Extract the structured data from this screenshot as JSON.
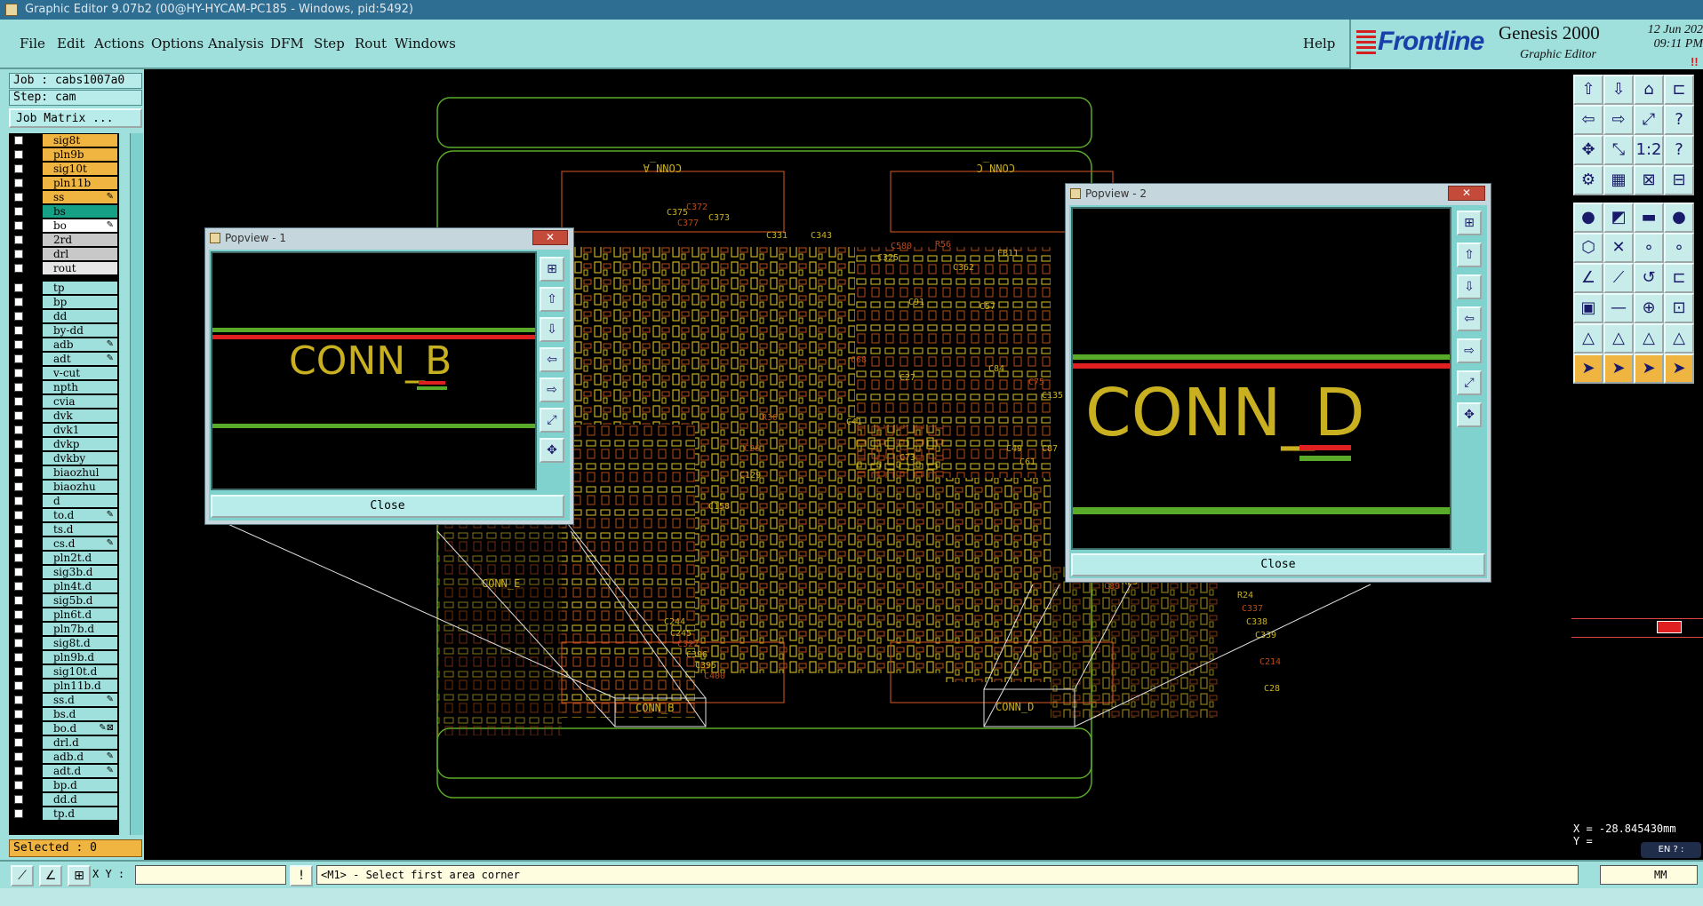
{
  "window": {
    "title": "Graphic Editor 9.07b2 (00@HY-HYCAM-PC185 - Windows, pid:5492)"
  },
  "menu": {
    "items": [
      "File",
      "Edit",
      "Actions",
      "Options",
      "Analysis",
      "DFM",
      "Step",
      "Rout",
      "Windows"
    ],
    "help": "Help"
  },
  "brand": {
    "logo": "Frontline",
    "product": "Genesis 2000",
    "subtitle": "Graphic Editor",
    "date": "12 Jun 202",
    "time": "09:11 PM",
    "indicator": "!!"
  },
  "job": {
    "job_label": "Job : cabs1007a0",
    "step_label": "Step: cam",
    "matrix_button": "Job Matrix ..."
  },
  "layers": [
    {
      "name": "sig8t",
      "color": "#f0b440",
      "mark": ""
    },
    {
      "name": "pln9b",
      "color": "#f0b440",
      "mark": ""
    },
    {
      "name": "sig10t",
      "color": "#f0b440",
      "mark": ""
    },
    {
      "name": "pln11b",
      "color": "#f0b440",
      "mark": ""
    },
    {
      "name": "ss",
      "color": "#f0b440",
      "mark": "✎"
    },
    {
      "name": "bs",
      "color": "#16a085",
      "mark": ""
    },
    {
      "name": "bo",
      "color": "#ffffff",
      "mark": "✎"
    },
    {
      "name": "2rd",
      "color": "#c8c8c8",
      "mark": ""
    },
    {
      "name": "drl",
      "color": "#c8c8c8",
      "mark": ""
    },
    {
      "name": "rout",
      "color": "#e6e6e6",
      "mark": ""
    },
    {
      "name": "tp",
      "color": "#9fdfdc",
      "mark": ""
    },
    {
      "name": "bp",
      "color": "#9fdfdc",
      "mark": ""
    },
    {
      "name": "dd",
      "color": "#9fdfdc",
      "mark": ""
    },
    {
      "name": "by-dd",
      "color": "#9fdfdc",
      "mark": ""
    },
    {
      "name": "adb",
      "color": "#9fdfdc",
      "mark": "✎"
    },
    {
      "name": "adt",
      "color": "#9fdfdc",
      "mark": "✎"
    },
    {
      "name": "v-cut",
      "color": "#9fdfdc",
      "mark": ""
    },
    {
      "name": "npth",
      "color": "#9fdfdc",
      "mark": ""
    },
    {
      "name": "cvia",
      "color": "#9fdfdc",
      "mark": ""
    },
    {
      "name": "dvk",
      "color": "#9fdfdc",
      "mark": ""
    },
    {
      "name": "dvk1",
      "color": "#9fdfdc",
      "mark": ""
    },
    {
      "name": "dvkp",
      "color": "#9fdfdc",
      "mark": ""
    },
    {
      "name": "dvkby",
      "color": "#9fdfdc",
      "mark": ""
    },
    {
      "name": "biaozhul",
      "color": "#9fdfdc",
      "mark": ""
    },
    {
      "name": "biaozhu",
      "color": "#9fdfdc",
      "mark": ""
    },
    {
      "name": "d",
      "color": "#9fdfdc",
      "mark": ""
    },
    {
      "name": "to.d",
      "color": "#9fdfdc",
      "mark": "✎"
    },
    {
      "name": "ts.d",
      "color": "#9fdfdc",
      "mark": ""
    },
    {
      "name": "cs.d",
      "color": "#9fdfdc",
      "mark": "✎"
    },
    {
      "name": "pln2t.d",
      "color": "#9fdfdc",
      "mark": ""
    },
    {
      "name": "sig3b.d",
      "color": "#9fdfdc",
      "mark": ""
    },
    {
      "name": "pln4t.d",
      "color": "#9fdfdc",
      "mark": ""
    },
    {
      "name": "sig5b.d",
      "color": "#9fdfdc",
      "mark": ""
    },
    {
      "name": "pln6t.d",
      "color": "#9fdfdc",
      "mark": ""
    },
    {
      "name": "pln7b.d",
      "color": "#9fdfdc",
      "mark": ""
    },
    {
      "name": "sig8t.d",
      "color": "#9fdfdc",
      "mark": ""
    },
    {
      "name": "pln9b.d",
      "color": "#9fdfdc",
      "mark": ""
    },
    {
      "name": "sig10t.d",
      "color": "#9fdfdc",
      "mark": ""
    },
    {
      "name": "pln11b.d",
      "color": "#9fdfdc",
      "mark": ""
    },
    {
      "name": "ss.d",
      "color": "#9fdfdc",
      "mark": "✎"
    },
    {
      "name": "bs.d",
      "color": "#9fdfdc",
      "mark": ""
    },
    {
      "name": "bo.d",
      "color": "#9fdfdc",
      "mark": "✎⊠"
    },
    {
      "name": "drl.d",
      "color": "#9fdfdc",
      "mark": ""
    },
    {
      "name": "adb.d",
      "color": "#9fdfdc",
      "mark": "✎"
    },
    {
      "name": "adt.d",
      "color": "#9fdfdc",
      "mark": "✎"
    },
    {
      "name": "bp.d",
      "color": "#9fdfdc",
      "mark": ""
    },
    {
      "name": "dd.d",
      "color": "#9fdfdc",
      "mark": ""
    },
    {
      "name": "tp.d",
      "color": "#9fdfdc",
      "mark": ""
    }
  ],
  "selected": "Selected : 0",
  "canvas": {
    "labels": {
      "conn_a": "CONN_A",
      "conn_c": "CONN_C",
      "conn_b": "CONN_B",
      "conn_d": "CONN_D",
      "conn_e": "CONN_E"
    },
    "silkscreen_text": [
      "C372",
      "C373",
      "C375",
      "C377",
      "C331",
      "C343",
      "C584",
      "FB2",
      "C585",
      "C580",
      "C362",
      "C325",
      "R56",
      "FB11",
      "C57",
      "C44",
      "C49",
      "C61",
      "C75",
      "C135",
      "C84",
      "C19",
      "C15",
      "C87",
      "C89",
      "C244",
      "C245",
      "C322",
      "C396",
      "C395",
      "C400",
      "R25",
      "R24",
      "C337",
      "C338",
      "C339",
      "C214",
      "C28",
      "C27",
      "C26",
      "C73",
      "C158",
      "R30",
      "C41",
      "C129",
      "C68",
      "C91",
      "C25"
    ]
  },
  "popview1": {
    "title": "Popview - 1",
    "text": "CONN_B",
    "close": "Close"
  },
  "popview2": {
    "title": "Popview - 2",
    "text": "CONN_D",
    "close": "Close"
  },
  "coords": {
    "x": "X = -28.845430mm",
    "y": "Y = "
  },
  "statusbar": {
    "xy_label": "X Y :",
    "xy_value": "",
    "message": "<M1> - Select first area corner",
    "unit": "MM"
  },
  "langbar": "EN ? :",
  "colors": {
    "panel": "#9fdfdc",
    "board_outline": "#5aaa2a",
    "component": "#c8b020",
    "copper": "#b84a1a",
    "line_red": "#e02020",
    "line_green": "#50a020"
  }
}
